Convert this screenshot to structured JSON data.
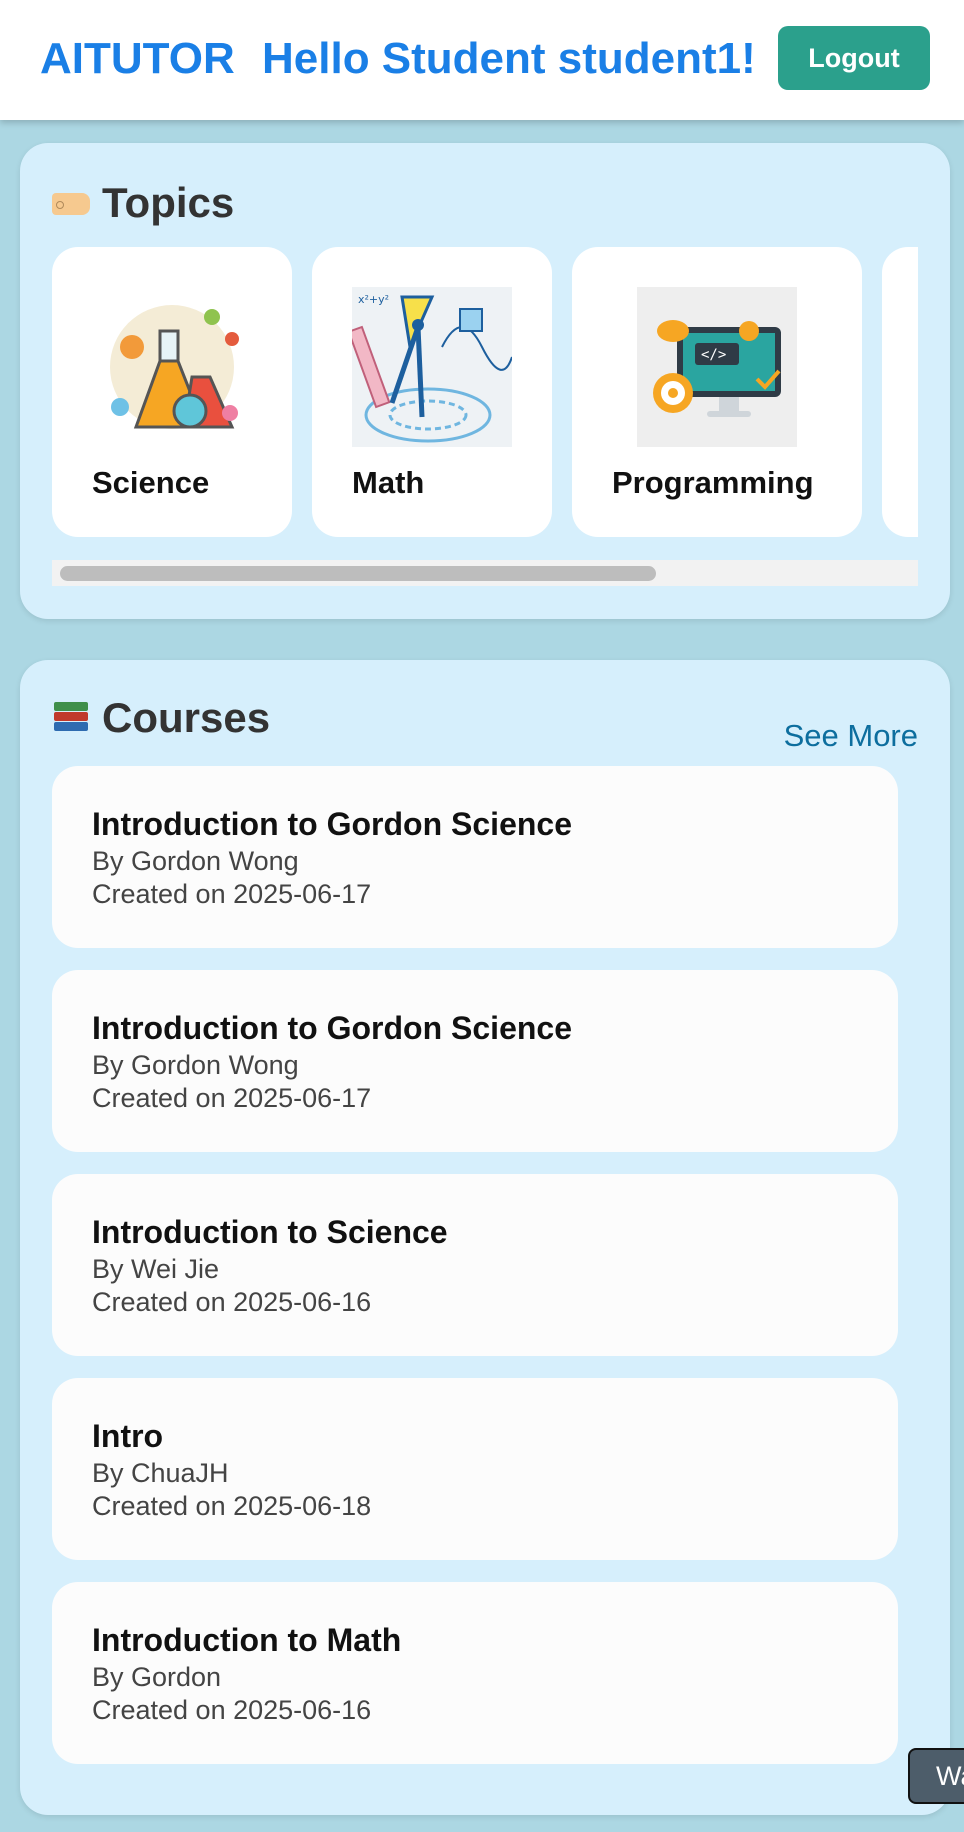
{
  "header": {
    "brand": "AITUTOR",
    "greeting": "Hello Student student1!",
    "logout_label": "Logout"
  },
  "topics": {
    "title": "Topics",
    "title_icon": "tag-icon",
    "items": [
      {
        "label": "Science",
        "icon": "science-flasks-icon"
      },
      {
        "label": "Math",
        "icon": "math-compass-icon"
      },
      {
        "label": "Programming",
        "icon": "programming-monitor-icon"
      }
    ]
  },
  "courses": {
    "title": "Courses",
    "title_icon": "books-icon",
    "see_more_label": "See More",
    "items": [
      {
        "title": "Introduction to Gordon Science",
        "author": "By Gordon Wong",
        "created": "Created on 2025-06-17"
      },
      {
        "title": "Introduction to Gordon Science",
        "author": "By Gordon Wong",
        "created": "Created on 2025-06-17"
      },
      {
        "title": "Introduction to Science",
        "author": "By Wei Jie",
        "created": "Created on 2025-06-16"
      },
      {
        "title": "Intro",
        "author": "By ChuaJH",
        "created": "Created on 2025-06-18"
      },
      {
        "title": "Introduction to Math",
        "author": "By Gordon",
        "created": "Created on 2025-06-16"
      }
    ]
  },
  "chat_widget": {
    "label": "Wa"
  },
  "colors": {
    "brand_blue": "#1a7fe6",
    "logout_green": "#2ba08c",
    "page_bg": "#acd7e3",
    "panel_bg": "#d6effc",
    "link": "#0d6e9e"
  }
}
